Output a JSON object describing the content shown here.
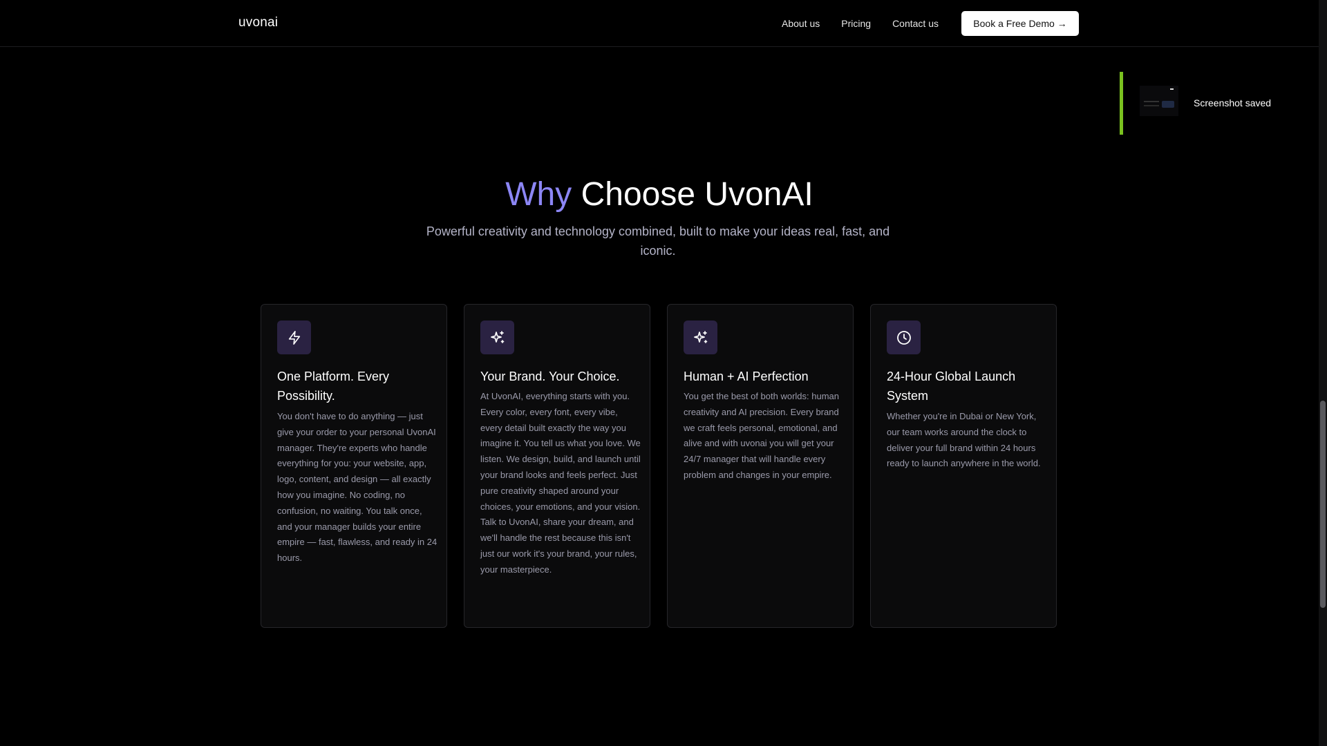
{
  "header": {
    "brand": "uvonai",
    "nav": [
      "About us",
      "Pricing",
      "Contact us"
    ],
    "cta_label": "Book a Free Demo →"
  },
  "toast": {
    "message": "Screenshot saved",
    "accent_color": "#7ac11f"
  },
  "section": {
    "title_accent": "Why",
    "title_rest": "Choose UvonAI",
    "subtitle": "Powerful creativity and technology combined, built to make your ideas real, fast, and iconic.",
    "accent_color": "#8c86f5"
  },
  "cards": [
    {
      "icon": "lightning-icon",
      "title": "One Platform. Every Possibility.",
      "body": "You don't have to do anything — just give your order to your personal UvonAI manager. They're experts who handle everything for you: your website, app, logo, content, and design — all exactly how you imagine. No coding, no confusion, no waiting. You talk once, and your manager builds your entire empire — fast, flawless, and ready in 24 hours."
    },
    {
      "icon": "sparkles-icon",
      "title": "Your Brand. Your Choice.",
      "body": "At UvonAI, everything starts with you. Every color, every font, every vibe, every detail built exactly the way you imagine it. You tell us what you love. We listen. We design, build, and launch until your brand looks and feels perfect. Just pure creativity shaped around your choices, your emotions, and your vision. Talk to UvonAI, share your dream, and we'll handle the rest because this isn't just our work it's your brand, your rules, your masterpiece."
    },
    {
      "icon": "sparkles-icon",
      "title": "Human + AI Perfection",
      "body": "You get the best of both worlds: human creativity and AI precision. Every brand we craft feels personal, emotional, and alive and with uvonai you will get your 24/7 manager that will handle every problem and changes in your empire."
    },
    {
      "icon": "clock-icon",
      "title": "24-Hour Global Launch System",
      "body": "Whether you're in Dubai or New York, our team works around the clock to deliver your full brand within 24 hours ready to launch anywhere in the world."
    }
  ]
}
